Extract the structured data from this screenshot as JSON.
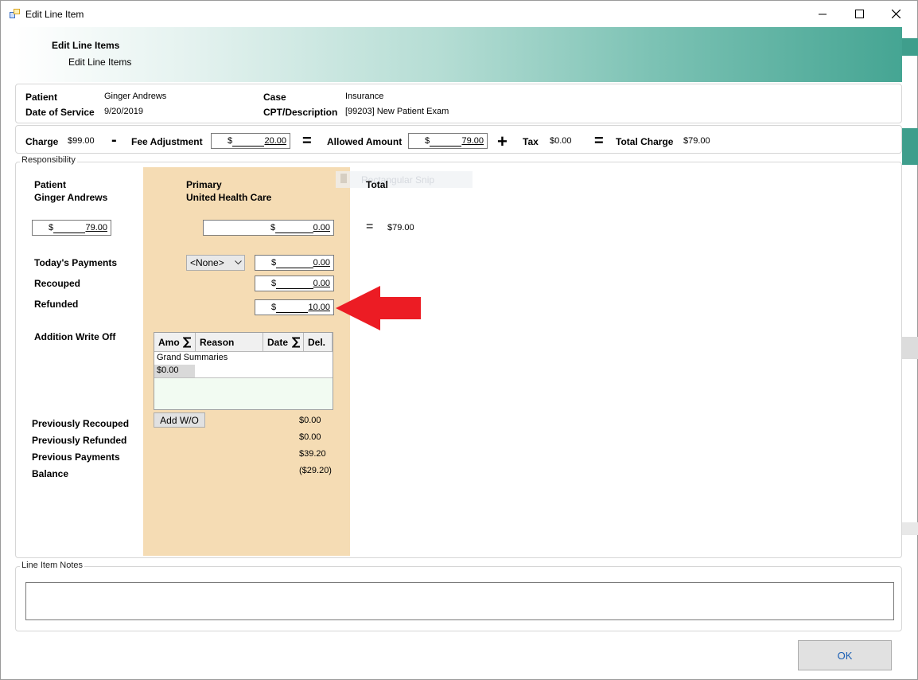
{
  "window": {
    "title": "Edit Line Item"
  },
  "banner": {
    "title": "Edit Line Items",
    "subtitle": "Edit Line Items"
  },
  "info": {
    "patient_label": "Patient",
    "patient_value": "Ginger Andrews",
    "dos_label": "Date of Service",
    "dos_value": "9/20/2019",
    "case_label": "Case",
    "case_value": "Insurance",
    "cpt_label": "CPT/Description",
    "cpt_value": "[99203] New Patient Exam"
  },
  "charge": {
    "charge_label": "Charge",
    "charge_value": "$99.00",
    "minus": "-",
    "fee_adj_label": "Fee Adjustment",
    "fee_adj_currency": "$",
    "fee_adj_value": "20.00",
    "equals": "=",
    "allowed_label": "Allowed Amount",
    "allowed_currency": "$",
    "allowed_value": "79.00",
    "plus": "+",
    "tax_label": "Tax",
    "tax_value": "$0.00",
    "total_label": "Total Charge",
    "total_value": "$79.00"
  },
  "responsibility": {
    "group_label": "Responsibility",
    "patient_header": "Patient",
    "patient_name": "Ginger Andrews",
    "primary_header": "Primary",
    "primary_name": "United Health Care",
    "total_header": "Total",
    "patient_resp_currency": "$",
    "patient_resp_value": "79.00",
    "primary_resp_currency": "$",
    "primary_resp_value": "0.00",
    "equals": "=",
    "total_value": "$79.00",
    "todays_payments_label": "Today's Payments",
    "payment_method": "<None>",
    "todays_payments_currency": "$",
    "todays_payments_value": "0.00",
    "recouped_label": "Recouped",
    "recouped_currency": "$",
    "recouped_value": "0.00",
    "refunded_label": "Refunded",
    "refunded_currency": "$",
    "refunded_value": "10.00",
    "write_off_label": "Addition Write Off",
    "grid": {
      "col_amount": "Amo",
      "col_reason": "Reason",
      "col_date": "Date",
      "col_del": "Del.",
      "summary_label": "Grand Summaries",
      "summary_amount": "$0.00"
    },
    "add_wo_button": "Add W/O",
    "prev_recouped_label": "Previously Recouped",
    "prev_recouped_value": "$0.00",
    "prev_refunded_label": "Previously Refunded",
    "prev_refunded_value": "$0.00",
    "prev_payments_label": "Previous Payments",
    "prev_payments_value": "$39.20",
    "balance_label": "Balance",
    "balance_value": "($29.20)"
  },
  "overlay": {
    "snip_text": "Rectangular Snip"
  },
  "notes": {
    "group_label": "Line Item Notes"
  },
  "footer": {
    "ok_label": "OK"
  },
  "colors": {
    "accent_teal": "#45a593",
    "resp_column": "#f5dcb4",
    "arrow_red": "#ec1c24",
    "ok_text": "#1a5fb4"
  },
  "icons": [
    "app-icon",
    "minimize-icon",
    "maximize-icon",
    "close-icon",
    "chevron-down-icon",
    "sigma-icon",
    "red-arrow-annotation"
  ]
}
